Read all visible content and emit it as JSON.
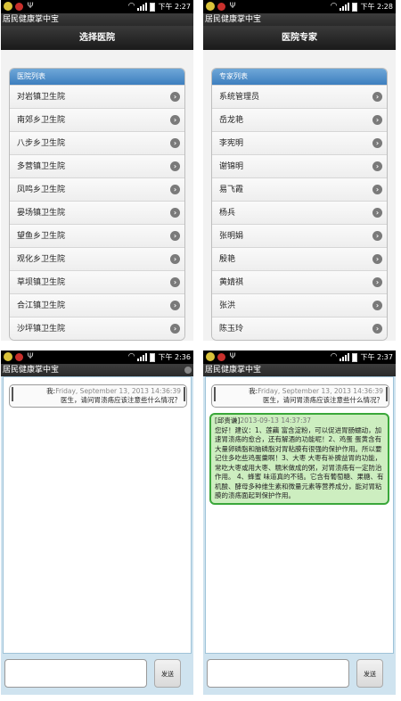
{
  "app_name": "居民健康掌中宝",
  "screens": [
    {
      "clock": "下午 2:27",
      "page_title": "选择医院",
      "list_header": "医院列表",
      "items": [
        "对岩镇卫生院",
        "南郊乡卫生院",
        "八步乡卫生院",
        "多营镇卫生院",
        "凤鸣乡卫生院",
        "晏场镇卫生院",
        "望鱼乡卫生院",
        "观化乡卫生院",
        "草坝镇卫生院",
        "合江镇卫生院",
        "沙坪镇卫生院"
      ]
    },
    {
      "clock": "下午 2:28",
      "page_title": "医院专家",
      "list_header": "专家列表",
      "items": [
        "系统管理员",
        "岳龙艳",
        "李宪明",
        "谢锦明",
        "易飞霞",
        "杨兵",
        "张明娟",
        "殷艳",
        "黄婧祺",
        "张洪",
        "陈玉玲"
      ]
    },
    {
      "clock": "下午 2:36",
      "me_label": "我:",
      "me_date": "Friday, September 13, 2013 14:36:39",
      "me_text": "医生，请问胃溃疡应该注意些什么情况？",
      "send_label": "发送"
    },
    {
      "clock": "下午 2:37",
      "me_label": "我:",
      "me_date": "Friday, September 13, 2013 14:36:39",
      "me_text": "医生，请问胃溃疡应该注意些什么情况？",
      "doc_label": "[邱贵谦]",
      "doc_date": "2013-09-13 14:37:37",
      "doc_text": "您好！建议：1、莲藕 富含淀粉，可以促进胃肠蠕动，加速胃溃疡的愈合，还有解酒的功能呢！2、鸡蛋 蛋黄含有大量卵磷脂和脑磷脂对胃粘膜有很强的保护作用。所以要记住多吃些鸡蛋羹啊！3、大枣 大枣有补脾益胃的功能，常吃大枣或用大枣、糯米做成的粥，对胃溃疡有一定防治作用。 4、蜂蜜 味道真的不错。它含有葡萄糖、果糖、有机酸、酵母多种维生素和微量元素等营养成分，能对胃粘膜的溃疡面起到保护作用。",
      "send_label": "发送"
    }
  ]
}
